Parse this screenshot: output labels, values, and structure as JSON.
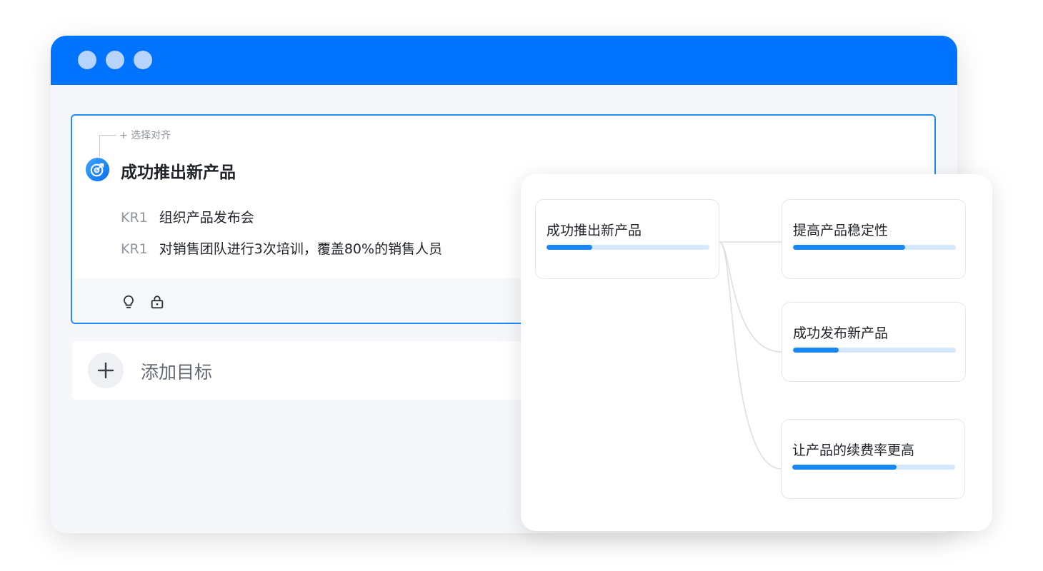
{
  "colors": {
    "titlebar": "#0074ff",
    "accent": "#1f8cff",
    "progress_fill": "#1987f5",
    "progress_track": "#d6e9fc"
  },
  "objective_card": {
    "align_link": "+ 选择对齐",
    "icon": "target-icon",
    "title": "成功推出新产品",
    "key_results": [
      {
        "tag": "KR1",
        "text": "组织产品发布会"
      },
      {
        "tag": "KR1",
        "text": "对销售团队进行3次培训，覆盖80%的销售人员"
      }
    ],
    "footer_icons": [
      "lightbulb-icon",
      "lock-icon"
    ]
  },
  "add_goal": {
    "icon": "plus-icon",
    "label": "添加目标"
  },
  "alignment_tree": {
    "root": {
      "label": "成功推出新产品",
      "progress": 0.28
    },
    "children": [
      {
        "label": "提高产品稳定性",
        "progress": 0.69
      },
      {
        "label": "成功发布新产品",
        "progress": 0.28
      },
      {
        "label": "让产品的续费率更高",
        "progress": 0.64
      }
    ]
  }
}
